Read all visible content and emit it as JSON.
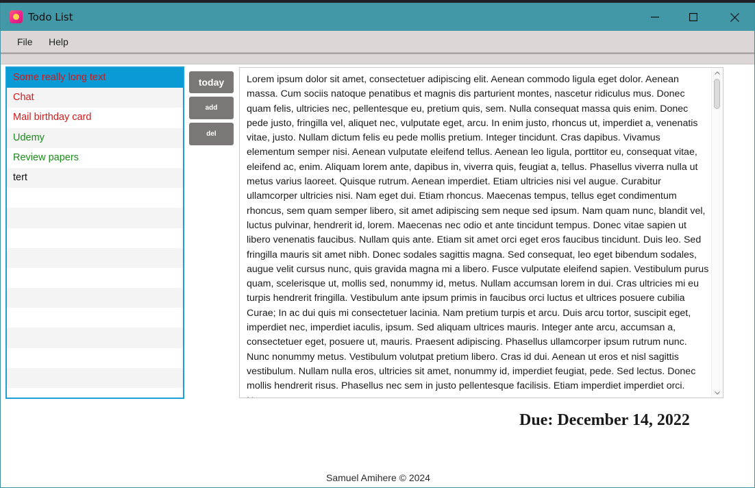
{
  "window": {
    "title": "Todo List",
    "accent_color": "#4298a7",
    "icons": {
      "minimize": "minimize-icon",
      "maximize": "maximize-icon",
      "close": "close-icon",
      "app": "app-icon"
    }
  },
  "menu": {
    "items": [
      {
        "label": "File"
      },
      {
        "label": "Help"
      }
    ]
  },
  "todo_list": {
    "selection_color": "#0a9ad4",
    "items": [
      {
        "label": "Some really long text",
        "color": "#d11a1a",
        "selected": true
      },
      {
        "label": "Chat",
        "color": "#d11a1a"
      },
      {
        "label": "Mail birthday card",
        "color": "#d11a1a"
      },
      {
        "label": "Udemy",
        "color": "#1a8a1a"
      },
      {
        "label": "Review papers",
        "color": "#1a8a1a"
      },
      {
        "label": "tert",
        "color": "#111111"
      }
    ],
    "empty_rows": 10
  },
  "buttons": {
    "today": "today",
    "add": "add",
    "del": "del"
  },
  "description": {
    "text": "Lorem ipsum dolor sit amet, consectetuer adipiscing elit. Aenean commodo ligula eget dolor. Aenean massa. Cum sociis natoque penatibus et magnis dis parturient montes, nascetur ridiculus mus. Donec quam felis, ultricies nec, pellentesque eu, pretium quis, sem. Nulla consequat massa quis enim. Donec pede justo, fringilla vel, aliquet nec, vulputate eget, arcu. In enim justo, rhoncus ut, imperdiet a, venenatis vitae, justo. Nullam dictum felis eu pede mollis pretium. Integer tincidunt. Cras dapibus. Vivamus elementum semper nisi. Aenean vulputate eleifend tellus. Aenean leo ligula, porttitor eu, consequat vitae, eleifend ac, enim. Aliquam lorem ante, dapibus in, viverra quis, feugiat a, tellus. Phasellus viverra nulla ut metus varius laoreet. Quisque rutrum. Aenean imperdiet. Etiam ultricies nisi vel augue. Curabitur ullamcorper ultricies nisi. Nam eget dui. Etiam rhoncus. Maecenas tempus, tellus eget condimentum rhoncus, sem quam semper libero, sit amet adipiscing sem neque sed ipsum. Nam quam nunc, blandit vel, luctus pulvinar, hendrerit id, lorem. Maecenas nec odio et ante tincidunt tempus. Donec vitae sapien ut libero venenatis faucibus. Nullam quis ante. Etiam sit amet orci eget eros faucibus tincidunt. Duis leo. Sed fringilla mauris sit amet nibh. Donec sodales sagittis magna. Sed consequat, leo eget bibendum sodales, augue velit cursus nunc, quis gravida magna mi a libero. Fusce vulputate eleifend sapien. Vestibulum purus quam, scelerisque ut, mollis sed, nonummy id, metus. Nullam accumsan lorem in dui. Cras ultricies mi eu turpis hendrerit fringilla. Vestibulum ante ipsum primis in faucibus orci luctus et ultrices posuere cubilia Curae; In ac dui quis mi consectetuer lacinia. Nam pretium turpis et arcu. Duis arcu tortor, suscipit eget, imperdiet nec, imperdiet iaculis, ipsum. Sed aliquam ultrices mauris. Integer ante arcu, accumsan a, consectetuer eget, posuere ut, mauris. Praesent adipiscing. Phasellus ullamcorper ipsum rutrum nunc. Nunc nonummy metus. Vestibulum volutpat pretium libero. Cras id dui. Aenean ut eros et nisl sagittis vestibulum. Nullam nulla eros, ultricies sit amet, nonummy id, imperdiet feugiat, pede. Sed lectus. Donec mollis hendrerit risus. Phasellus nec sem in justo pellentesque facilisis. Etiam imperdiet imperdiet orci. Nunc nec"
  },
  "due": {
    "label": "Due: December 14, 2022"
  },
  "footer": {
    "text": "Samuel Amihere © 2024"
  }
}
